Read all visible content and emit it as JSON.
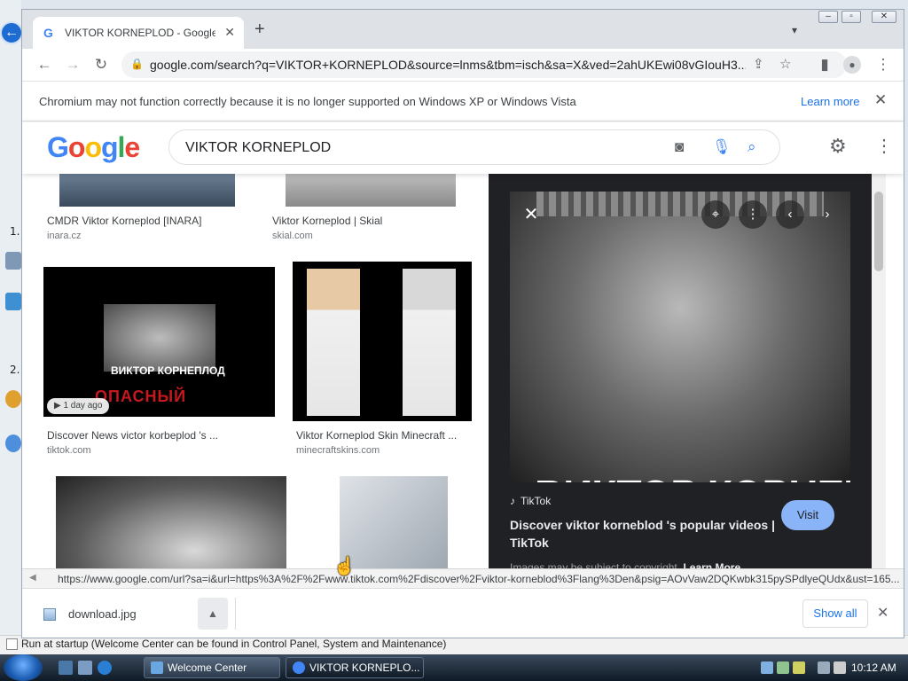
{
  "browser": {
    "tab_title": "VIKTOR KORNEPLOD - Google Search",
    "tab_favicon": "G",
    "url": "google.com/search?q=VIKTOR+KORNEPLOD&source=lnms&tbm=isch&sa=X&ved=2ahUKEwi08vGIouH3...",
    "infobar_message": "Chromium may not function correctly because it is no longer supported on Windows XP or Windows Vista",
    "infobar_link": "Learn more"
  },
  "google": {
    "logo_letters": [
      "G",
      "o",
      "o",
      "g",
      "l",
      "e"
    ],
    "logo_colors": [
      "#4285f4",
      "#ea4335",
      "#fbbc05",
      "#4285f4",
      "#34a853",
      "#ea4335"
    ],
    "query": "VIKTOR KORNEPLOD"
  },
  "results": [
    {
      "caption": "CMDR Viktor Korneplod [INARA]",
      "source": "inara.cz"
    },
    {
      "caption": "Viktor Korneplod | Skial",
      "source": "skial.com"
    },
    {
      "caption": "Discover News victor korbeplod 's ...",
      "source": "tiktok.com",
      "badge": "1 day ago",
      "overlay_text": "ВИКТОР КОРНЕПЛОД",
      "overlay_red": "ОПАСНЫЙ"
    },
    {
      "caption": "Viktor Korneplod Skin Minecraft ...",
      "source": "minecraftskins.com"
    }
  ],
  "preview": {
    "overlay_text": "ВИКТОР КОРНЕПЛ",
    "source": "TikTok",
    "title": "Discover viktor korneblod 's popular videos | TikTok",
    "visit_label": "Visit",
    "copyright": "Images may be subject to copyright.",
    "learn_more": "Learn More"
  },
  "status_url": "https://www.google.com/url?sa=i&url=https%3A%2F%2Fwww.tiktok.com%2Fdiscover%2Fviktor-korneblod%3Flang%3Den&psig=AOvVaw2DQKwbk315pySPdlyeQUdx&ust=165...",
  "download": {
    "filename": "download.jpg",
    "show_all": "Show all"
  },
  "desktop": {
    "num1": "1.",
    "num2": "2.",
    "startup_text": "Run at startup (Welcome Center can be found in Control Panel, System and Maintenance)"
  },
  "taskbar": {
    "items": [
      "Welcome Center",
      "VIKTOR KORNEPLO..."
    ],
    "clock": "10:12 AM"
  }
}
